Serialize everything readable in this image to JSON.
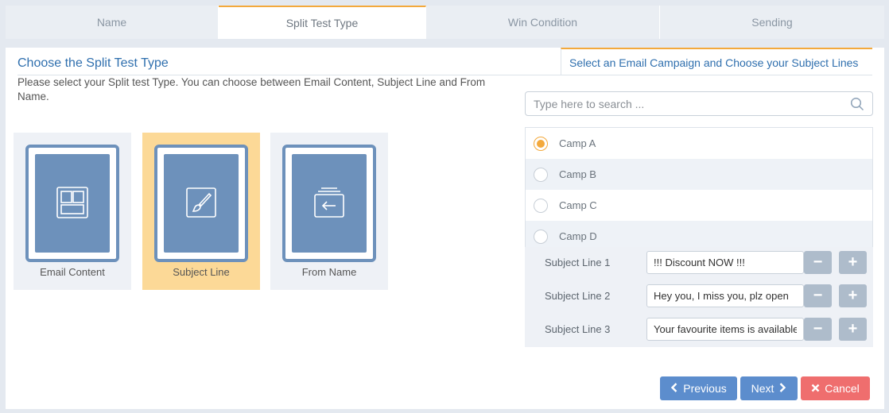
{
  "tabs": [
    {
      "label": "Name"
    },
    {
      "label": "Split Test Type"
    },
    {
      "label": "Win Condition"
    },
    {
      "label": "Sending"
    }
  ],
  "left": {
    "title": "Choose the Split Test Type",
    "description": "Please select your Split test Type. You can choose between Email Content, Subject Line and From Name.",
    "types": [
      {
        "label": "Email Content",
        "icon": "layout-icon",
        "selected": false
      },
      {
        "label": "Subject Line",
        "icon": "brush-icon",
        "selected": true
      },
      {
        "label": "From Name",
        "icon": "inbox-stack-icon",
        "selected": false
      }
    ]
  },
  "right": {
    "title": "Select an Email Campaign and Choose your Subject Lines",
    "search": {
      "placeholder": "Type here to search ...",
      "value": ""
    },
    "campaigns": [
      {
        "label": "Camp A",
        "checked": true
      },
      {
        "label": "Camp B",
        "checked": false
      },
      {
        "label": "Camp C",
        "checked": false
      },
      {
        "label": "Camp D",
        "checked": false
      }
    ],
    "subject_lines": [
      {
        "label": "Subject Line 1",
        "value": "!!! Discount NOW !!!"
      },
      {
        "label": "Subject Line 2",
        "value": "Hey you, I miss you, plz open"
      },
      {
        "label": "Subject Line 3",
        "value": "Your favourite items is available"
      }
    ]
  },
  "footer": {
    "previous": "Previous",
    "next": "Next",
    "cancel": "Cancel"
  },
  "colors": {
    "accent": "#f3a93c",
    "primary": "#5c8dcd",
    "danger": "#ef6e6e",
    "tile": "#6d91bb",
    "selected_card": "#fcd997"
  }
}
